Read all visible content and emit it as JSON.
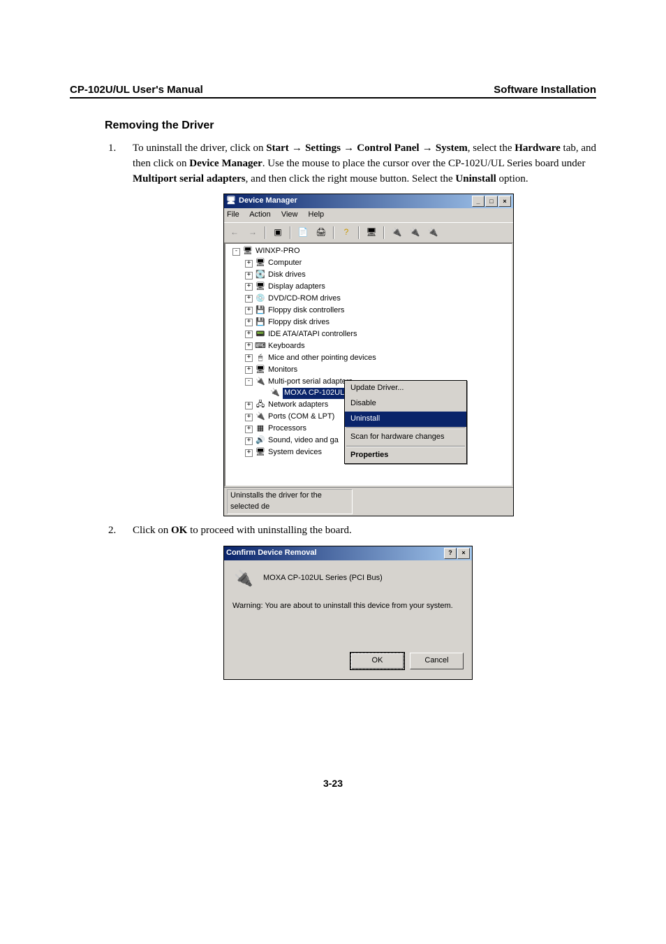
{
  "header": {
    "left": "CP-102U/UL User's Manual",
    "right": "Software Installation"
  },
  "section_title": "Removing the Driver",
  "step1": {
    "num": "1.",
    "pre": "To uninstall the driver, click on ",
    "start": "Start",
    "arr1": " → ",
    "settings": "Settings",
    "arr2": " → ",
    "cpanel": "Control Panel",
    "arr3": " → ",
    "system": "System",
    "mid1": ", select the ",
    "hardware": "Hardware",
    "mid2": " tab, and then click on ",
    "devmgr": "Device Manager",
    "mid3": ". Use the mouse to place the cursor over the CP-102U/UL Series board under ",
    "multiport": "Multiport serial adapters",
    "mid4": ", and then click the right mouse button. Select the ",
    "uninstall": "Uninstall",
    "mid5": " option."
  },
  "step2": {
    "num": "2.",
    "pre": "Click on ",
    "ok": "OK",
    "post": " to proceed with uninstalling the board."
  },
  "dm": {
    "title": "Device Manager",
    "menu": {
      "file": "File",
      "action": "Action",
      "view": "View",
      "help": "Help"
    },
    "root": "WINXP-PRO",
    "nodes": {
      "computer": "Computer",
      "disk": "Disk drives",
      "display": "Display adapters",
      "dvd": "DVD/CD-ROM drives",
      "fdc": "Floppy disk controllers",
      "fdd": "Floppy disk drives",
      "ide": "IDE ATA/ATAPI controllers",
      "kbd": "Keyboards",
      "mice": "Mice and other pointing devices",
      "mon": "Monitors",
      "multiport": "Multi-port serial adapters",
      "moxa": "MOXA CP-102UL Series (PCI Bus)",
      "net": "Network adapters",
      "ports": "Ports (COM & LPT)",
      "proc": "Processors",
      "sound": "Sound, video and ga",
      "sys": "System devices"
    },
    "ctx": {
      "update": "Update Driver...",
      "disable": "Disable",
      "uninstall": "Uninstall",
      "scan": "Scan for hardware changes",
      "props": "Properties"
    },
    "status": "Uninstalls the driver for the selected de"
  },
  "dlg": {
    "title": "Confirm Device Removal",
    "device": "MOXA CP-102UL Series (PCI Bus)",
    "warning": "Warning: You are about to uninstall this device from your system.",
    "ok": "OK",
    "cancel": "Cancel"
  },
  "page_number": "3-23"
}
